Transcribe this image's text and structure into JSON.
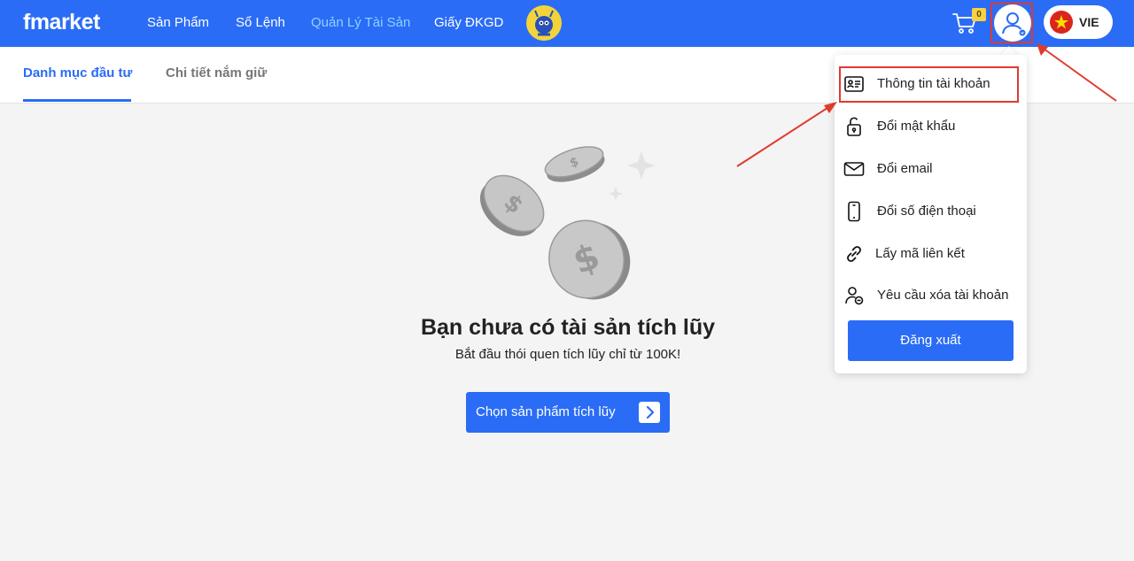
{
  "brand": {
    "logo": "fmarket",
    "accent": "#2a6cf6",
    "annotation_color": "#e03a2f"
  },
  "nav": {
    "items": [
      {
        "label": "Sản Phẩm",
        "active": false
      },
      {
        "label": "Sổ Lệnh",
        "active": false
      },
      {
        "label": "Quản Lý Tài Sản",
        "active": true
      },
      {
        "label": "Giấy ĐKGD",
        "active": false
      }
    ],
    "cart_count": "0",
    "language": "VIE",
    "icons": [
      "mascot-icon",
      "cart-icon",
      "user-icon",
      "vietnam-flag-icon"
    ]
  },
  "tabs": [
    {
      "label": "Danh mục đầu tư",
      "active": true
    },
    {
      "label": "Chi tiết nắm giữ",
      "active": false
    }
  ],
  "empty_state": {
    "title": "Bạn chưa có tài sản tích lũy",
    "subtitle": "Bắt đầu thói quen tích lũy chỉ từ 100K!",
    "cta_label": "Chọn sản phẩm tích lũy"
  },
  "account_menu": {
    "items": [
      {
        "label": "Thông tin tài khoản",
        "icon": "id-card-icon"
      },
      {
        "label": "Đổi mật khẩu",
        "icon": "unlock-icon"
      },
      {
        "label": "Đổi email",
        "icon": "mail-icon"
      },
      {
        "label": "Đổi số điện thoại",
        "icon": "phone-icon"
      },
      {
        "label": "Lấy mã liên kết",
        "icon": "link-icon"
      },
      {
        "label": "Yêu cầu xóa tài khoản",
        "icon": "delete-user-icon"
      }
    ],
    "logout_label": "Đăng xuất"
  }
}
